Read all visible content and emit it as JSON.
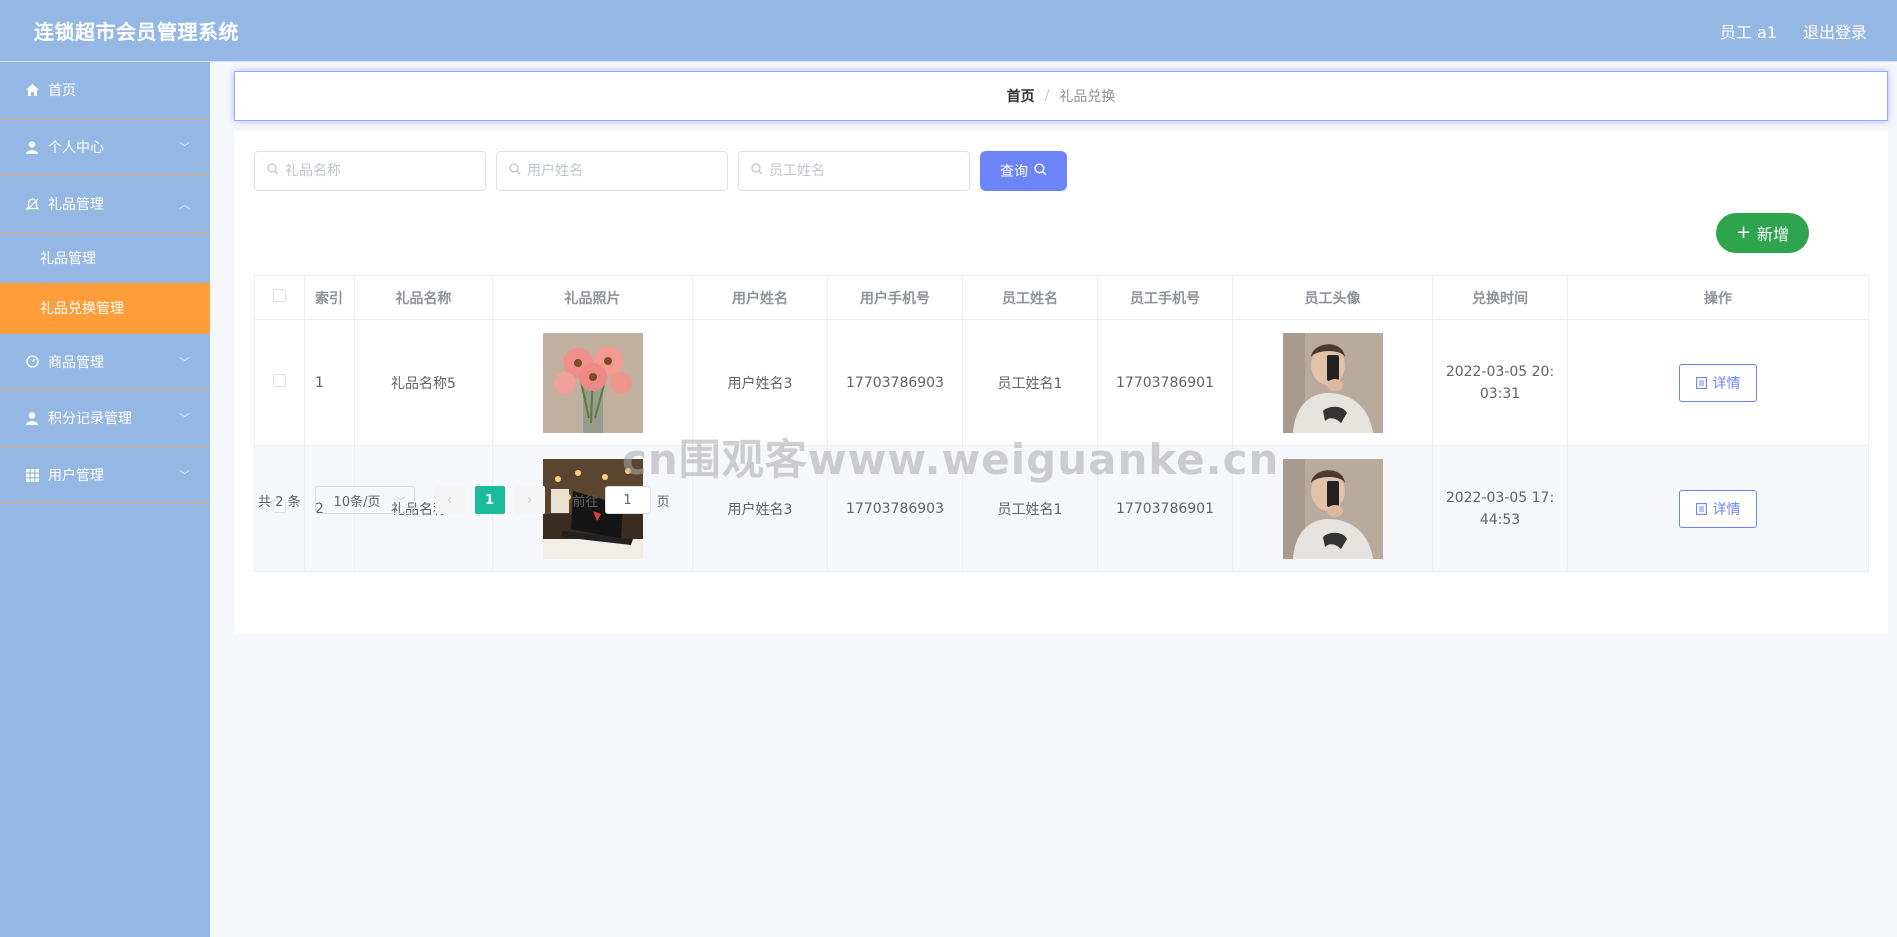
{
  "header": {
    "title": "连锁超市会员管理系统",
    "user": "员工 a1",
    "logout": "退出登录"
  },
  "sidebar": {
    "items": [
      {
        "label": "首页",
        "icon": "home-icon"
      },
      {
        "label": "个人中心",
        "icon": "user-icon"
      },
      {
        "label": "礼品管理",
        "icon": "gift-icon",
        "expanded": true,
        "children": [
          "礼品管理",
          "礼品兑换管理"
        ]
      },
      {
        "label": "商品管理",
        "icon": "dashboard-icon"
      },
      {
        "label": "积分记录管理",
        "icon": "user-icon"
      },
      {
        "label": "用户管理",
        "icon": "grid-icon"
      }
    ],
    "active": "礼品兑换管理",
    "active_color": "#fe9e3b",
    "bg_color": "#94b7e3"
  },
  "breadcrumb": {
    "home": "首页",
    "separator": "/",
    "current": "礼品兑换"
  },
  "search": {
    "gift_name_placeholder": "礼品名称",
    "user_name_placeholder": "用户姓名",
    "staff_name_placeholder": "员工姓名",
    "query_label": "查询"
  },
  "add_label": "新增",
  "table": {
    "columns": [
      "索引",
      "礼品名称",
      "礼品照片",
      "用户姓名",
      "用户手机号",
      "员工姓名",
      "员工手机号",
      "员工头像",
      "兑换时间",
      "操作"
    ],
    "rows": [
      {
        "index": "1",
        "gift_name": "礼品名称5",
        "user_name": "用户姓名3",
        "user_phone": "17703786903",
        "staff_name": "员工姓名1",
        "staff_phone": "17703786901",
        "time": "2022-03-05 20:03:31",
        "action": "详情"
      },
      {
        "index": "2",
        "gift_name": "礼品名称1",
        "user_name": "用户姓名3",
        "user_phone": "17703786903",
        "staff_name": "员工姓名1",
        "staff_phone": "17703786901",
        "time": "2022-03-05 17:44:53",
        "action": "详情"
      }
    ]
  },
  "pagination": {
    "total": "共 2 条",
    "page_size": "10条/页",
    "current": "1",
    "goto_prefix": "前往",
    "goto_value": "1",
    "goto_suffix": "页"
  },
  "watermark": "cn围观客www.weiguanke.cn",
  "colors": {
    "primary": "#6c84f7",
    "success": "#2ea44f",
    "pager_active": "#1bbc9b"
  }
}
